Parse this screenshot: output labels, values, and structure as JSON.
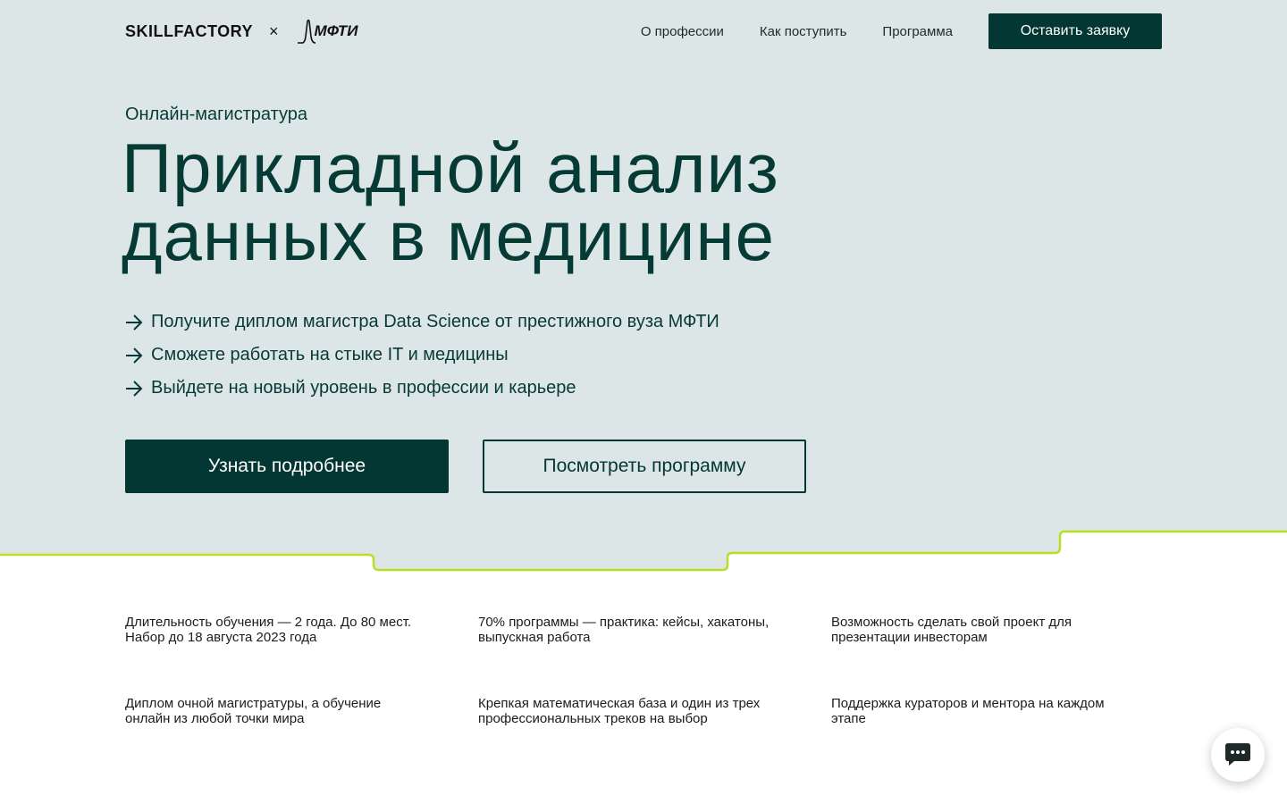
{
  "header": {
    "logo_primary": "SKILLFACTORY",
    "logo_separator": "×",
    "logo_partner": "МФТИ",
    "nav": [
      {
        "label": "О профессии"
      },
      {
        "label": "Как поступить"
      },
      {
        "label": "Программа"
      }
    ],
    "apply_label": "Оставить заявку"
  },
  "hero": {
    "eyebrow": "Онлайн-магистратура",
    "title_line1": "Прикладной анализ",
    "title_line2": "данных в медицине",
    "benefits": [
      {
        "text": "Получите диплом магистра Data Science от престижного вуза МФТИ"
      },
      {
        "text": "Сможете работать на стыке IT и медицины"
      },
      {
        "text": "Выйдете на новый уровень в профессии и карьере"
      }
    ],
    "primary_button": "Узнать подробнее",
    "secondary_button": "Посмотреть программу"
  },
  "features": [
    {
      "text": "Длительность обучения — 2 года. До 80 мест. Набор до 18 августа 2023 года"
    },
    {
      "text": "70% программы — практика: кейсы, хакатоны, выпускная работа"
    },
    {
      "text": "Возможность сделать свой проект для презентации инвесторам"
    },
    {
      "text": "Диплом очной магистратуры, а обучение онлайн из любой точки мира"
    },
    {
      "text": "Крепкая математическая база и один из трех профессиональных треков на выбор"
    },
    {
      "text": "Поддержка кураторов и ментора на каждом этапе"
    }
  ],
  "chat": {
    "icon": "chat-bubble-icon"
  },
  "colors": {
    "hero_bg": "#dde6e6",
    "accent": "#033733",
    "line": "#b8e020"
  }
}
